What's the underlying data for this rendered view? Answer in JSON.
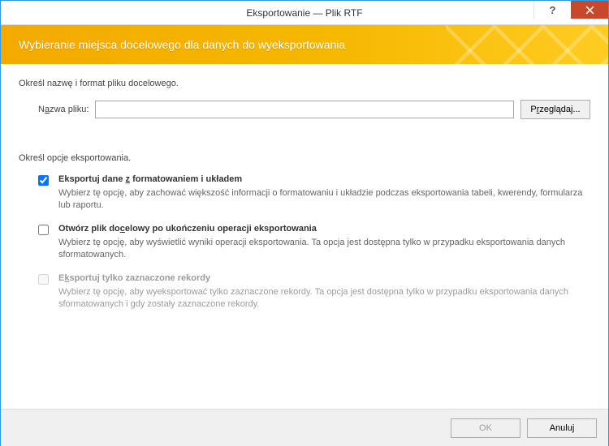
{
  "titlebar": {
    "title": "Eksportowanie — Plik RTF"
  },
  "banner": {
    "text": "Wybieranie miejsca docelowego dla danych do wyeksportowania"
  },
  "section1": {
    "label": "Określ nazwę i format pliku docelowego."
  },
  "file_row": {
    "label_pre": "N",
    "label_u": "a",
    "label_post": "zwa pliku:",
    "value": "",
    "browse_pre": "P",
    "browse_u": "r",
    "browse_post": "zeglądaj..."
  },
  "section2": {
    "label": "Określ opcje eksportowania."
  },
  "options": [
    {
      "checked": true,
      "disabled": false,
      "title_pre": "Eksportuj dane ",
      "title_u": "z",
      "title_post": " formatowaniem i układem",
      "desc": "Wybierz tę opcję, aby zachować większość informacji o formatowaniu i układzie podczas eksportowania tabeli, kwerendy, formularza lub raportu."
    },
    {
      "checked": false,
      "disabled": false,
      "title_pre": "Otwórz plik do",
      "title_u": "c",
      "title_post": "elowy po ukończeniu operacji eksportowania",
      "desc": "Wybierz tę opcję, aby wyświetlić wyniki operacji eksportowania. Ta opcja jest dostępna tylko w przypadku eksportowania danych sformatowanych."
    },
    {
      "checked": false,
      "disabled": true,
      "title_pre": "E",
      "title_u": "k",
      "title_post": "sportuj tylko zaznaczone rekordy",
      "desc": "Wybierz tę opcję, aby wyeksportować tylko zaznaczone rekordy. Ta opcja jest dostępna tylko w przypadku eksportowania danych sformatowanych i gdy zostały zaznaczone rekordy."
    }
  ],
  "footer": {
    "ok": "OK",
    "cancel": "Anuluj"
  }
}
